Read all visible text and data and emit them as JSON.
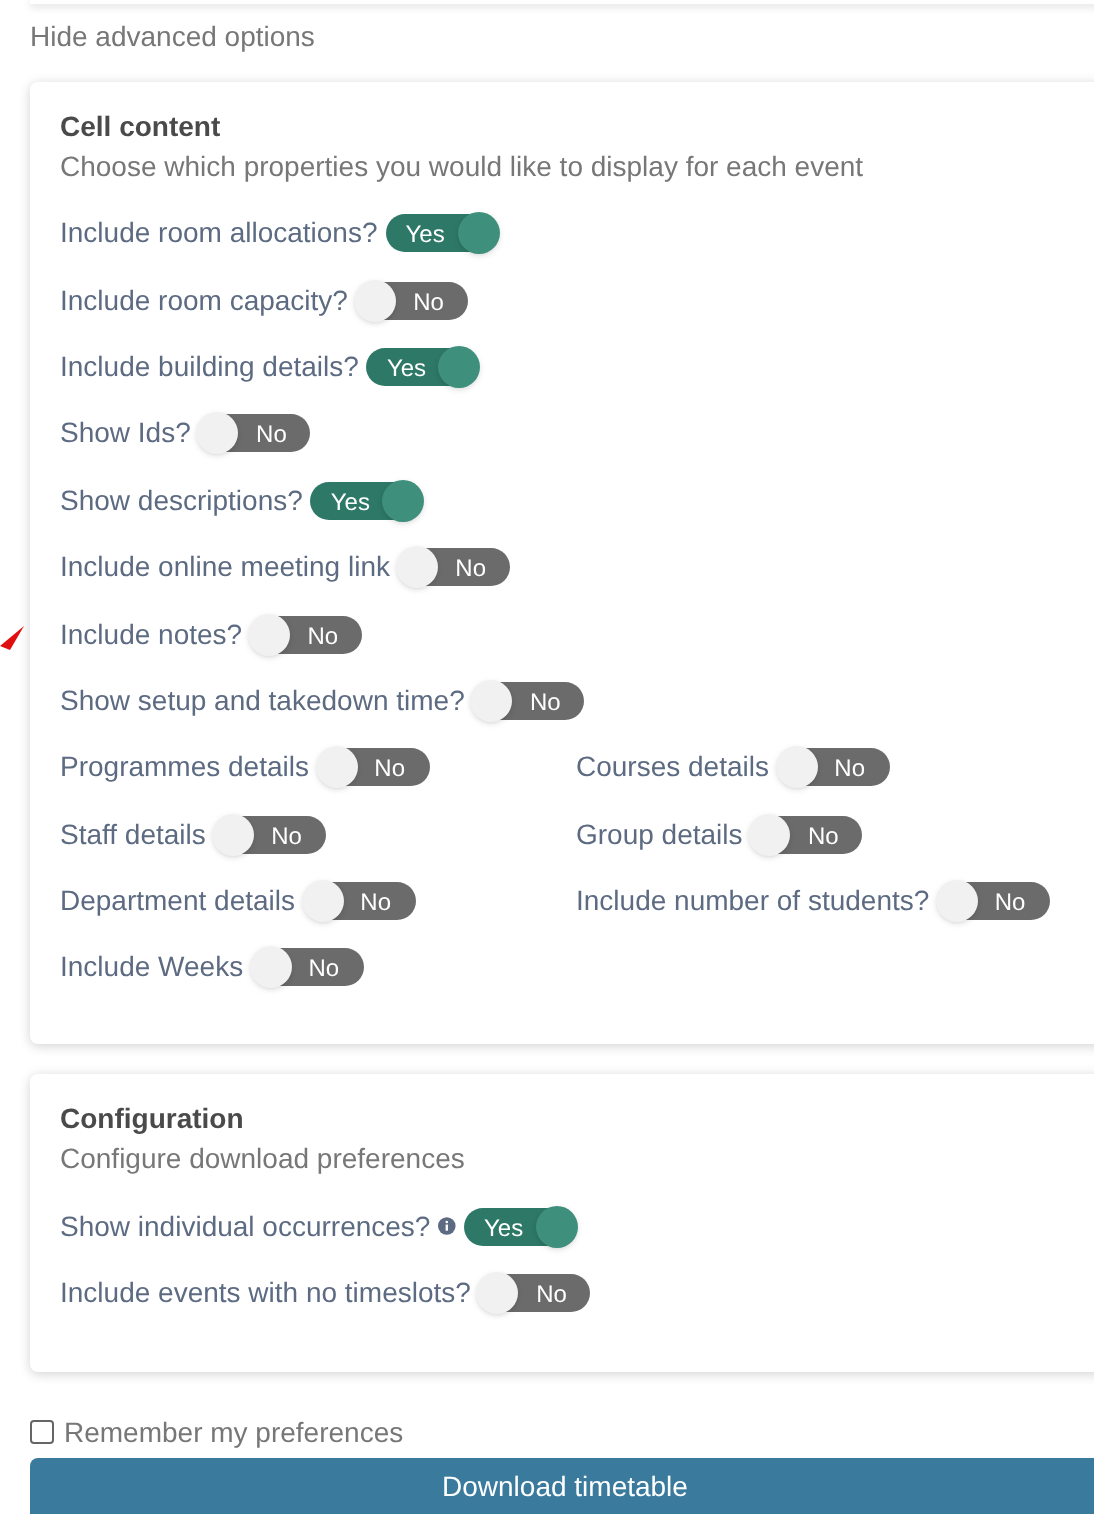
{
  "advanced_link": "Hide advanced options",
  "cell_content": {
    "title": "Cell content",
    "description": "Choose which properties you would like to display for each event",
    "rows": [
      [
        {
          "label": "Include room allocations?",
          "on": true,
          "toggle_text": "Yes"
        }
      ],
      [
        {
          "label": "Include room capacity?",
          "on": false,
          "toggle_text": "No"
        }
      ],
      [
        {
          "label": "Include building details?",
          "on": true,
          "toggle_text": "Yes"
        }
      ],
      [
        {
          "label": "Show Ids?",
          "on": false,
          "toggle_text": "No"
        }
      ],
      [
        {
          "label": "Show descriptions?",
          "on": true,
          "toggle_text": "Yes"
        }
      ],
      [
        {
          "label": "Include online meeting link",
          "on": false,
          "toggle_text": "No"
        }
      ],
      [
        {
          "label": "Include notes?",
          "on": false,
          "toggle_text": "No"
        }
      ],
      [
        {
          "label": "Show setup and takedown time?",
          "on": false,
          "toggle_text": "No"
        }
      ],
      [
        {
          "label": "Programmes details",
          "on": false,
          "toggle_text": "No"
        },
        {
          "label": "Courses details",
          "on": false,
          "toggle_text": "No"
        }
      ],
      [
        {
          "label": "Staff details",
          "on": false,
          "toggle_text": "No"
        },
        {
          "label": "Group details",
          "on": false,
          "toggle_text": "No"
        }
      ],
      [
        {
          "label": "Department details",
          "on": false,
          "toggle_text": "No"
        },
        {
          "label": "Include number of students?",
          "on": false,
          "toggle_text": "No"
        }
      ],
      [
        {
          "label": "Include Weeks",
          "on": false,
          "toggle_text": "No"
        }
      ]
    ]
  },
  "configuration": {
    "title": "Configuration",
    "description": "Configure download preferences",
    "rows": [
      [
        {
          "label": "Show individual occurrences?",
          "info": true,
          "on": true,
          "toggle_text": "Yes"
        }
      ],
      [
        {
          "label": "Include events with no timeslots?",
          "on": false,
          "toggle_text": "No"
        }
      ]
    ]
  },
  "remember": {
    "label": "Remember my preferences",
    "checked": false
  },
  "download_button": "Download timetable"
}
